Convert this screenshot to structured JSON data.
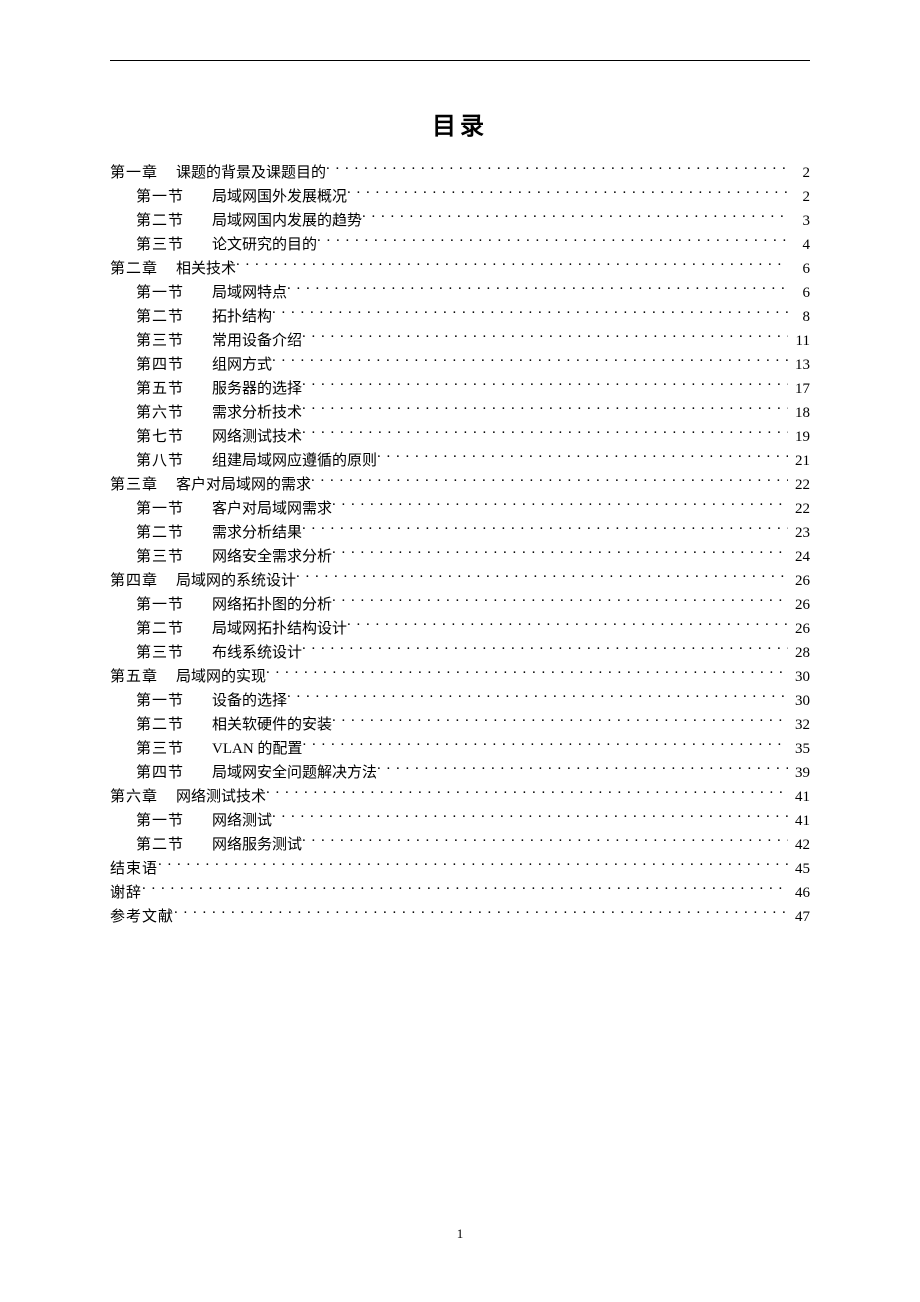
{
  "title": "目录",
  "page_number": "1",
  "toc": [
    {
      "level": 0,
      "label": "第一章",
      "title": "课题的背景及课题目的",
      "page": "2"
    },
    {
      "level": 1,
      "label": "第一节",
      "title": "局域网国外发展概况",
      "page": "2"
    },
    {
      "level": 1,
      "label": "第二节",
      "title": "局域网国内发展的趋势",
      "page": "3"
    },
    {
      "level": 1,
      "label": "第三节",
      "title": "论文研究的目的",
      "page": "4"
    },
    {
      "level": 0,
      "label": "第二章",
      "title": "相关技术",
      "page": "6"
    },
    {
      "level": 1,
      "label": "第一节",
      "title": "局域网特点",
      "page": "6"
    },
    {
      "level": 1,
      "label": "第二节",
      "title": "拓扑结构",
      "page": "8"
    },
    {
      "level": 1,
      "label": "第三节",
      "title": "常用设备介绍",
      "page": "11"
    },
    {
      "level": 1,
      "label": "第四节",
      "title": "组网方式",
      "page": "13"
    },
    {
      "level": 1,
      "label": "第五节",
      "title": "服务器的选择",
      "page": "17"
    },
    {
      "level": 1,
      "label": "第六节",
      "title": "需求分析技术",
      "page": "18"
    },
    {
      "level": 1,
      "label": "第七节",
      "title": "网络测试技术",
      "page": "19"
    },
    {
      "level": 1,
      "label": "第八节",
      "title": "组建局域网应遵循的原则",
      "page": "21"
    },
    {
      "level": 0,
      "label": "第三章",
      "title": "客户对局域网的需求",
      "page": "22"
    },
    {
      "level": 1,
      "label": "第一节",
      "title": "客户对局域网需求",
      "page": "22"
    },
    {
      "level": 1,
      "label": "第二节",
      "title": "需求分析结果",
      "page": "23"
    },
    {
      "level": 1,
      "label": "第三节",
      "title": "网络安全需求分析",
      "page": "24"
    },
    {
      "level": 0,
      "label": "第四章",
      "title": "局域网的系统设计",
      "page": "26"
    },
    {
      "level": 1,
      "label": "第一节",
      "title": "网络拓扑图的分析",
      "page": "26"
    },
    {
      "level": 1,
      "label": "第二节",
      "title": "局域网拓扑结构设计",
      "page": "26"
    },
    {
      "level": 1,
      "label": "第三节",
      "title": "布线系统设计",
      "page": "28"
    },
    {
      "level": 0,
      "label": "第五章",
      "title": "局域网的实现",
      "page": "30"
    },
    {
      "level": 1,
      "label": "第一节",
      "title": "设备的选择",
      "page": "30"
    },
    {
      "level": 1,
      "label": "第二节",
      "title": "相关软硬件的安装",
      "page": "32"
    },
    {
      "level": 1,
      "label": "第三节",
      "title": "VLAN 的配置",
      "page": "35"
    },
    {
      "level": 1,
      "label": "第四节",
      "title": "局域网安全问题解决方法",
      "page": "39"
    },
    {
      "level": 0,
      "label": "第六章",
      "title": "网络测试技术",
      "page": "41"
    },
    {
      "level": 1,
      "label": "第一节",
      "title": "网络测试",
      "page": "41"
    },
    {
      "level": 1,
      "label": "第二节",
      "title": "网络服务测试",
      "page": "42"
    },
    {
      "level": 0,
      "label": "结束语",
      "title": "",
      "page": "45"
    },
    {
      "level": 0,
      "label": "谢辞",
      "title": "",
      "page": "46"
    },
    {
      "level": 0,
      "label": "参考文献",
      "title": "",
      "page": "47"
    }
  ]
}
